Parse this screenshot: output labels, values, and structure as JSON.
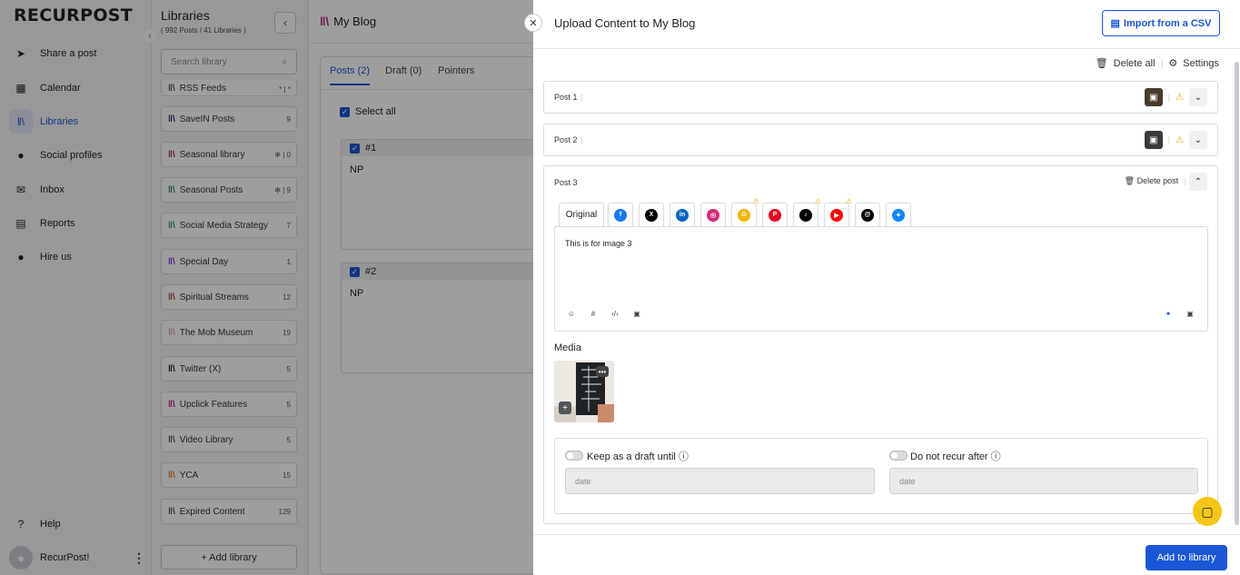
{
  "brand": {
    "logo": "RECURPOST"
  },
  "nav": {
    "items": [
      {
        "label": "Share a post",
        "icon": "send-icon",
        "glyph": "➤"
      },
      {
        "label": "Calendar",
        "icon": "calendar-icon",
        "glyph": "▦"
      },
      {
        "label": "Libraries",
        "icon": "libraries-icon",
        "glyph": "‖\\"
      },
      {
        "label": "Social profiles",
        "icon": "profile-icon",
        "glyph": "●"
      },
      {
        "label": "Inbox",
        "icon": "inbox-icon",
        "glyph": "✉"
      },
      {
        "label": "Reports",
        "icon": "reports-icon",
        "glyph": "▤"
      },
      {
        "label": "Hire us",
        "icon": "person-icon",
        "glyph": "●"
      }
    ],
    "help": "Help",
    "user": "RecurPost!"
  },
  "libraries": {
    "title": "Libraries",
    "count": "( 992 Posts / 41 Libraries )",
    "search_placeholder": "Search library",
    "items": [
      {
        "name": "RSS Feeds",
        "count": "* | *",
        "color": "#555555"
      },
      {
        "name": "SaveIN Posts",
        "count": "9",
        "color": "#1a3a7a"
      },
      {
        "name": "Seasonal library",
        "count": "✻ | 0",
        "color": "#b4237a"
      },
      {
        "name": "Seasonal Posts",
        "count": "✻ | 9",
        "color": "#2a8a8a"
      },
      {
        "name": "Social Media Strategy",
        "count": "7",
        "color": "#2a9a4a"
      },
      {
        "name": "Special Day",
        "count": "1",
        "color": "#7a3ad6"
      },
      {
        "name": "Spiritual Streams",
        "count": "12",
        "color": "#c0392b"
      },
      {
        "name": "The Mob Museum",
        "count": "19",
        "color": "#d6a0b0"
      },
      {
        "name": "Twitter (X)",
        "count": "5",
        "color": "#222222"
      },
      {
        "name": "Upclick Features",
        "count": "5",
        "color": "#b4237a"
      },
      {
        "name": "Video Library",
        "count": "5",
        "color": "#555555"
      },
      {
        "name": "YCA",
        "count": "15",
        "color": "#e67e22"
      },
      {
        "name": "Expired Content",
        "count": "129",
        "color": "#555555"
      }
    ],
    "add_label": "+ Add library"
  },
  "main": {
    "title": "My Blog",
    "tabs": [
      "Posts (2)",
      "Draft (0)",
      "Pointers"
    ],
    "select_all": "Select all",
    "posts": [
      {
        "num": "#1",
        "text": "NP"
      },
      {
        "num": "#2",
        "text": "NP"
      }
    ]
  },
  "drawer": {
    "title": "Upload Content to My Blog",
    "import_label": "Import from a CSV",
    "delete_all": "Delete all",
    "settings": "Settings",
    "collapsed_posts": [
      "Post 1",
      "Post 2"
    ],
    "post3": {
      "label": "Post 3",
      "delete_label": "Delete post",
      "original_tab": "Original",
      "networks": [
        {
          "name": "facebook-icon",
          "color": "#1877f2",
          "glyph": "f",
          "warn": false
        },
        {
          "name": "x-icon",
          "color": "#000000",
          "glyph": "X",
          "warn": false
        },
        {
          "name": "linkedin-icon",
          "color": "#0a66c2",
          "glyph": "in",
          "warn": false
        },
        {
          "name": "instagram-icon",
          "color": "#d62976",
          "glyph": "◎",
          "warn": false
        },
        {
          "name": "google-business-icon",
          "color": "#f4b400",
          "glyph": "G",
          "warn": true
        },
        {
          "name": "pinterest-icon",
          "color": "#e60023",
          "glyph": "P",
          "warn": false
        },
        {
          "name": "tiktok-icon",
          "color": "#000000",
          "glyph": "♪",
          "warn": true
        },
        {
          "name": "youtube-icon",
          "color": "#ff0000",
          "glyph": "▶",
          "warn": true
        },
        {
          "name": "threads-icon",
          "color": "#000000",
          "glyph": "@",
          "warn": false
        },
        {
          "name": "bluesky-icon",
          "color": "#1185fe",
          "glyph": "✦",
          "warn": false
        }
      ],
      "text": "This is for image 3",
      "media_label": "Media",
      "draft_label": "Keep as a draft until",
      "recur_label": "Do not recur after",
      "date_placeholder": "date"
    },
    "submit_label": "Add to library"
  }
}
